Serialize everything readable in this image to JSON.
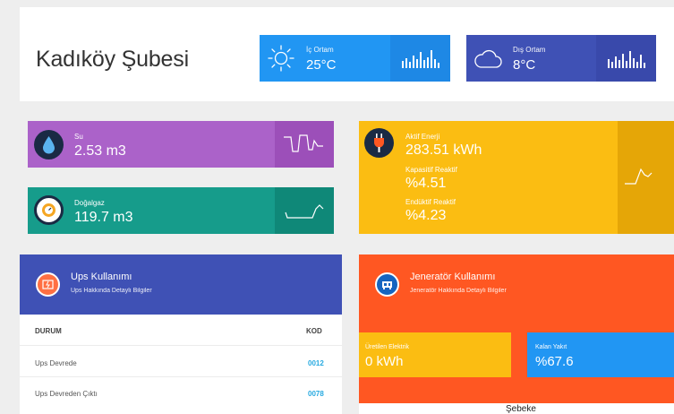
{
  "header": {
    "title": "Kadıköy Şubesi"
  },
  "weather": {
    "indoor": {
      "label": "İç Ortam",
      "value": "25°C",
      "icon": "sun-icon"
    },
    "outdoor": {
      "label": "Dış Ortam",
      "value": "8°C",
      "icon": "cloud-icon"
    }
  },
  "tiles": {
    "su": {
      "label": "Su",
      "value": "2.53 m3",
      "icon": "water-drop-icon"
    },
    "dogalgaz": {
      "label": "Doğalgaz",
      "value": "119.7 m3",
      "icon": "gas-meter-icon"
    },
    "energy": {
      "active_label": "Aktif Enerji",
      "active_value": "283.51 kWh",
      "cap_label": "Kapasitif Reaktif",
      "cap_value": "%4.51",
      "ind_label": "Endüktif Reaktif",
      "ind_value": "%4.23",
      "icon": "plug-icon"
    }
  },
  "ups": {
    "title": "Ups Kullanımı",
    "subtitle": "Ups Hakkında Detaylı Bilgiler",
    "col_status": "DURUM",
    "col_code": "KOD",
    "rows": [
      {
        "status": "Ups Devrede",
        "code": "0012"
      },
      {
        "status": "Ups Devreden Çıktı",
        "code": "0078"
      }
    ]
  },
  "generator": {
    "title": "Jeneratör Kullanımı",
    "subtitle": "Jeneratör Hakkında Detaylı Bilgiler",
    "produced_label": "Üretilen Elektrik",
    "produced_value": "0 kWh",
    "fuel_label": "Kalan Yakıt",
    "fuel_value": "%67.6",
    "grid_label": "Şebeke"
  },
  "colors": {
    "indoor": "#2196f3",
    "outdoor": "#3f51b5",
    "su": "#ab62c9",
    "dogalgaz": "#169c8b",
    "energy": "#fbbd12",
    "ups": "#3f51b5",
    "generator": "#ff5722"
  }
}
